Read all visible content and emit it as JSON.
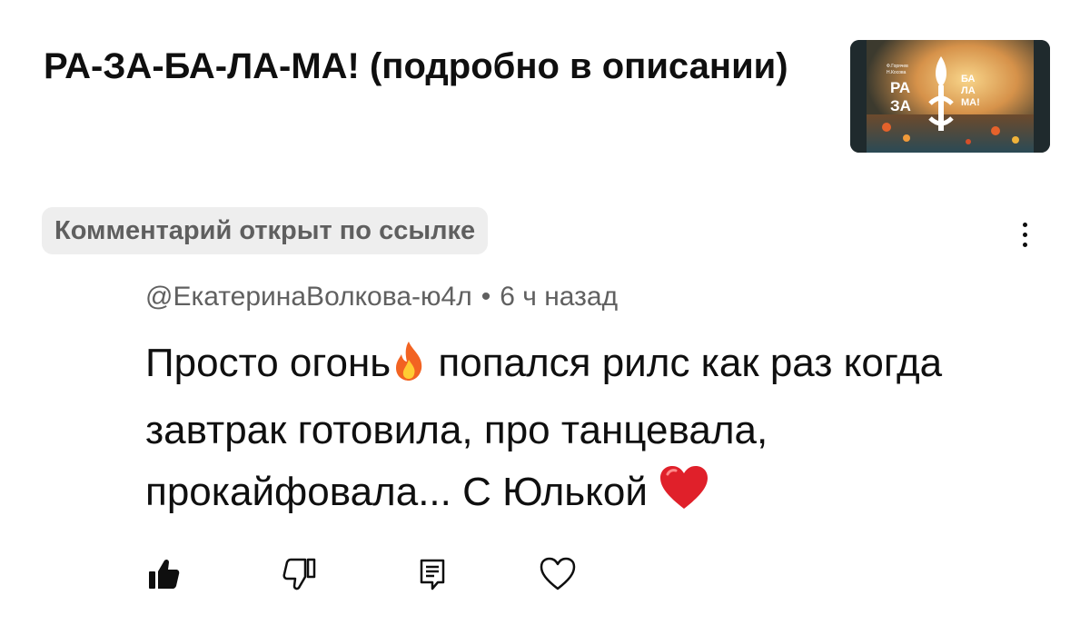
{
  "video": {
    "title": "РА-ЗА-БА-ЛА-МА! (подробно в описании)",
    "thumbnail": {
      "lines_left": [
        "РА",
        "ЗА"
      ],
      "lines_right": [
        "БА",
        "ЛА",
        "МА!"
      ],
      "small_text": [
        "Ф.Горячев",
        "Н.Косова"
      ]
    }
  },
  "chip": {
    "label": "Комментарий открыт по ссылке"
  },
  "comment": {
    "author": "@ЕкатеринаВолкова-ю4л",
    "separator": "•",
    "time": "6 ч назад",
    "text_part1": "Просто огонь",
    "text_part2": " попался рилс как раз когда завтрак готовила, про танцевала, прокайфовала... С Юлькой ",
    "emoji_1": "fire",
    "emoji_2": "red-heart"
  },
  "actions": [
    {
      "name": "like",
      "icon": "thumbs-up-filled-icon",
      "state": "active"
    },
    {
      "name": "dislike",
      "icon": "thumbs-down-outline-icon"
    },
    {
      "name": "reply",
      "icon": "reply-comment-icon"
    },
    {
      "name": "heart",
      "icon": "heart-outline-icon"
    }
  ],
  "colors": {
    "text": "#0f0f0f",
    "secondary": "#606060",
    "chip_bg": "#eeeeee",
    "heart": "#e0202a",
    "fire_outer": "#f26322",
    "fire_inner": "#ffcc33"
  }
}
